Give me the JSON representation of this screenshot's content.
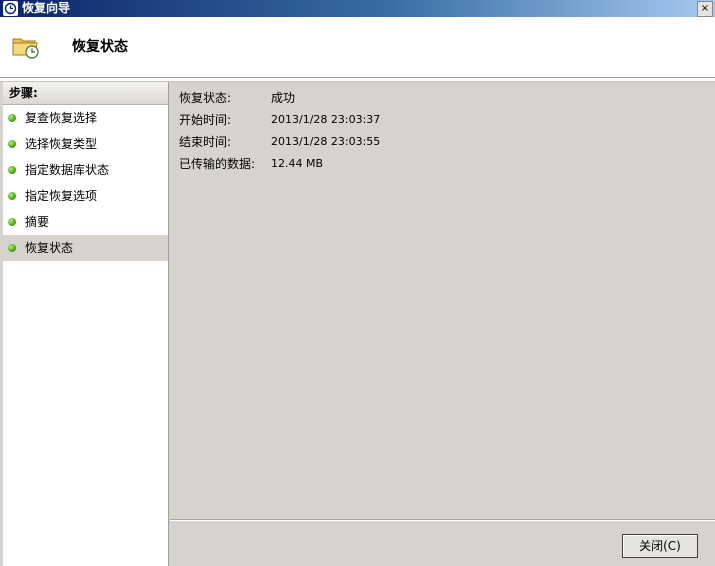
{
  "window": {
    "title": "恢复向导",
    "close_glyph": "×"
  },
  "header": {
    "title": "恢复状态",
    "icon": "folder-restore-icon"
  },
  "sidebar": {
    "header": "步骤:",
    "items": [
      {
        "label": "复查恢复选择"
      },
      {
        "label": "选择恢复类型"
      },
      {
        "label": "指定数据库状态"
      },
      {
        "label": "指定恢复选项"
      },
      {
        "label": "摘要"
      },
      {
        "label": "恢复状态",
        "active": true
      }
    ]
  },
  "status": {
    "recovery_status_label": "恢复状态:",
    "recovery_status_value": "成功",
    "start_time_label": "开始时间:",
    "start_time_value": "2013/1/28 23:03:37",
    "end_time_label": "结束时间:",
    "end_time_value": "2013/1/28 23:03:55",
    "transferred_label": "已传输的数据:",
    "transferred_value": "12.44 MB"
  },
  "footer": {
    "close_label": "关闭(C)"
  },
  "colors": {
    "title_bar": "#0a246a",
    "panel": "#d6d3ce",
    "step_dot": "#4fae1a"
  }
}
